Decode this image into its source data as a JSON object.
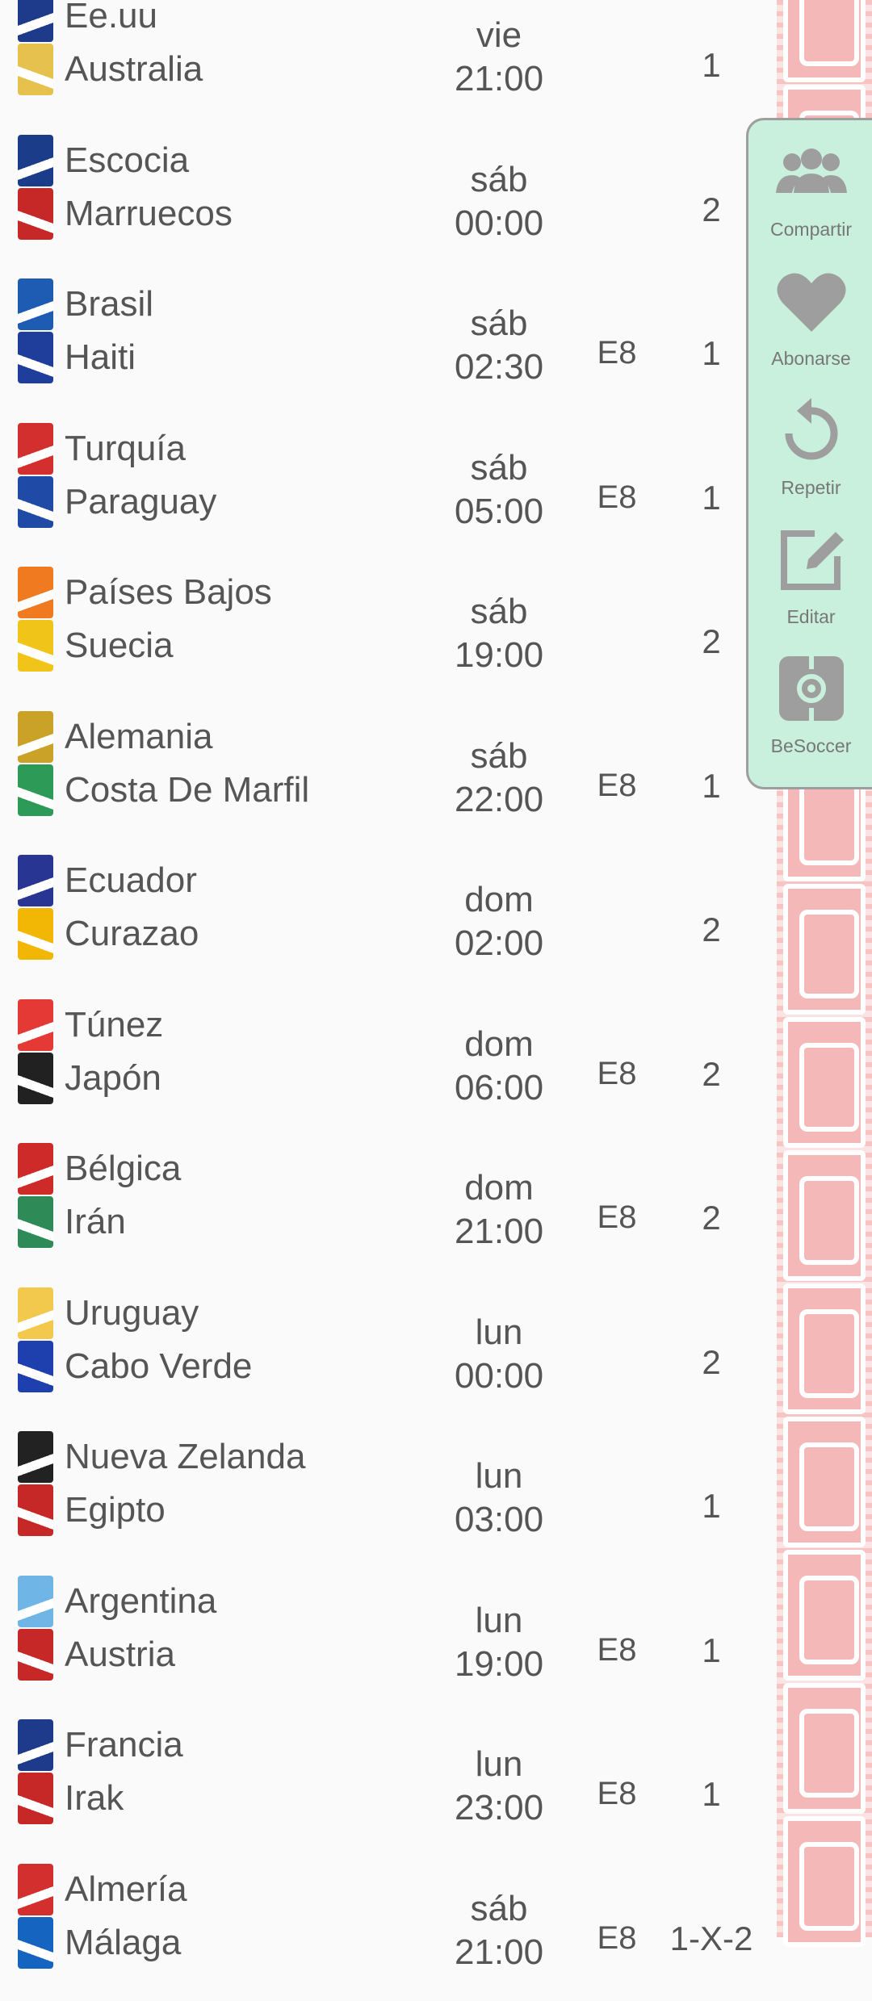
{
  "matches": [
    {
      "home": "Ee.uu",
      "away": "Australia",
      "day": "vie",
      "time": "21:00",
      "tag": "",
      "pick": "1",
      "colors": [
        "#1e3a8a",
        "#e7c14d"
      ]
    },
    {
      "home": "Escocia",
      "away": "Marruecos",
      "day": "sáb",
      "time": "00:00",
      "tag": "",
      "pick": "2",
      "colors": [
        "#1b3c88",
        "#c62828"
      ]
    },
    {
      "home": "Brasil",
      "away": "Haiti",
      "day": "sáb",
      "time": "02:30",
      "tag": "E8",
      "pick": "1",
      "colors": [
        "#1e5cb3",
        "#1f3e9c"
      ]
    },
    {
      "home": "Turquía",
      "away": "Paraguay",
      "day": "sáb",
      "time": "05:00",
      "tag": "E8",
      "pick": "1",
      "colors": [
        "#d32f2f",
        "#1f4aa6"
      ]
    },
    {
      "home": "Países Bajos",
      "away": "Suecia",
      "day": "sáb",
      "time": "19:00",
      "tag": "",
      "pick": "2",
      "colors": [
        "#f07a1f",
        "#f0c419"
      ]
    },
    {
      "home": "Alemania",
      "away": "Costa De Marfil",
      "day": "sáb",
      "time": "22:00",
      "tag": "E8",
      "pick": "1",
      "colors": [
        "#c9a227",
        "#2e9a57"
      ]
    },
    {
      "home": "Ecuador",
      "away": "Curazao",
      "day": "dom",
      "time": "02:00",
      "tag": "",
      "pick": "2",
      "colors": [
        "#283593",
        "#f2b705"
      ]
    },
    {
      "home": "Túnez",
      "away": "Japón",
      "day": "dom",
      "time": "06:00",
      "tag": "E8",
      "pick": "2",
      "colors": [
        "#e53935",
        "#212121"
      ]
    },
    {
      "home": "Bélgica",
      "away": "Irán",
      "day": "dom",
      "time": "21:00",
      "tag": "E8",
      "pick": "2",
      "colors": [
        "#cf2a2a",
        "#2e8b57"
      ]
    },
    {
      "home": "Uruguay",
      "away": "Cabo Verde",
      "day": "lun",
      "time": "00:00",
      "tag": "",
      "pick": "2",
      "colors": [
        "#f2c94c",
        "#1e40af"
      ]
    },
    {
      "home": "Nueva Zelanda",
      "away": "Egipto",
      "day": "lun",
      "time": "03:00",
      "tag": "",
      "pick": "1",
      "colors": [
        "#222222",
        "#c62828"
      ]
    },
    {
      "home": "Argentina",
      "away": "Austria",
      "day": "lun",
      "time": "19:00",
      "tag": "E8",
      "pick": "1",
      "colors": [
        "#6fb6e6",
        "#c62828"
      ]
    },
    {
      "home": "Francia",
      "away": "Irak",
      "day": "lun",
      "time": "23:00",
      "tag": "E8",
      "pick": "1",
      "colors": [
        "#1e3a8a",
        "#c62828"
      ]
    },
    {
      "home": "Almería",
      "away": "Málaga",
      "day": "sáb",
      "time": "21:00",
      "tag": "E8",
      "pick": "1-X-2",
      "colors": [
        "#d32f2f",
        "#1565c0"
      ]
    }
  ],
  "panel": {
    "share": "Compartir",
    "subscribe": "Abonarse",
    "repeat": "Repetir",
    "edit": "Editar",
    "besoccer": "BeSoccer"
  },
  "icons": {
    "share": "group-icon",
    "subscribe": "heart-icon",
    "repeat": "replay-icon",
    "edit": "edit-icon",
    "besoccer": "besoccer-icon"
  },
  "accent": "#c8f0dd",
  "icon_color": "#9e9e9e",
  "decor_color": "#f7c3c3"
}
